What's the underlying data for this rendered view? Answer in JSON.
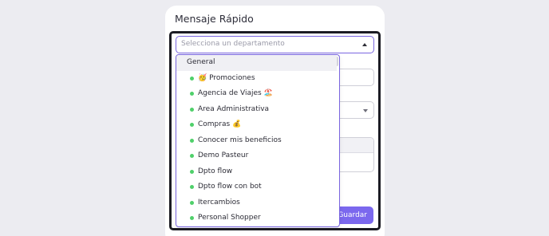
{
  "card": {
    "title": "Mensaje Rápido",
    "save_label": "Guardar"
  },
  "department_select": {
    "placeholder": "Selecciona un departamento",
    "state": "open"
  },
  "dropdown": {
    "group_label": "General",
    "status_dot_color": "#4fd06a",
    "items": [
      {
        "label": "🥳 Promociones"
      },
      {
        "label": "Agencia de Viajes 🏖️"
      },
      {
        "label": "Area Administrativa"
      },
      {
        "label": "Compras 💰"
      },
      {
        "label": "Conocer mis beneficios"
      },
      {
        "label": "Demo Pasteur"
      },
      {
        "label": "Dpto flow"
      },
      {
        "label": "Dpto flow con bot"
      },
      {
        "label": "Itercambios"
      },
      {
        "label": "Personal Shopper"
      }
    ]
  },
  "colors": {
    "accent": "#7b68ee",
    "focus_border": "#1c1c24"
  }
}
